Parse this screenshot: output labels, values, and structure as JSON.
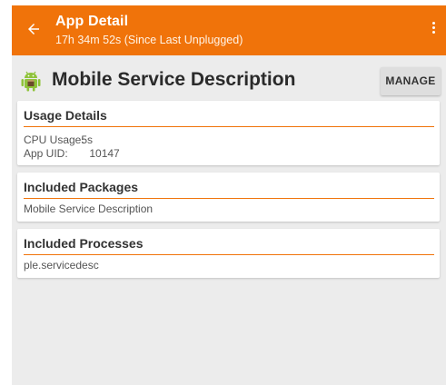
{
  "appbar": {
    "title": "App Detail",
    "subtitle": "17h 34m 52s (Since Last Unplugged)",
    "back_icon": "arrow-back-icon",
    "overflow_icon": "more-vert-icon",
    "color": "#f0730a"
  },
  "header": {
    "app_name": "Mobile Service Description",
    "app_icon": "android-icon",
    "manage_label": "MANAGE"
  },
  "usage_details": {
    "title": "Usage Details",
    "cpu_label": "CPU Usage:",
    "cpu_value": "5s",
    "uid_label": "App UID:",
    "uid_value": "10147"
  },
  "included_packages": {
    "title": "Included Packages",
    "items": [
      "Mobile Service Description"
    ]
  },
  "included_processes": {
    "title": "Included Processes",
    "items": [
      "ple.servicedesc"
    ]
  }
}
